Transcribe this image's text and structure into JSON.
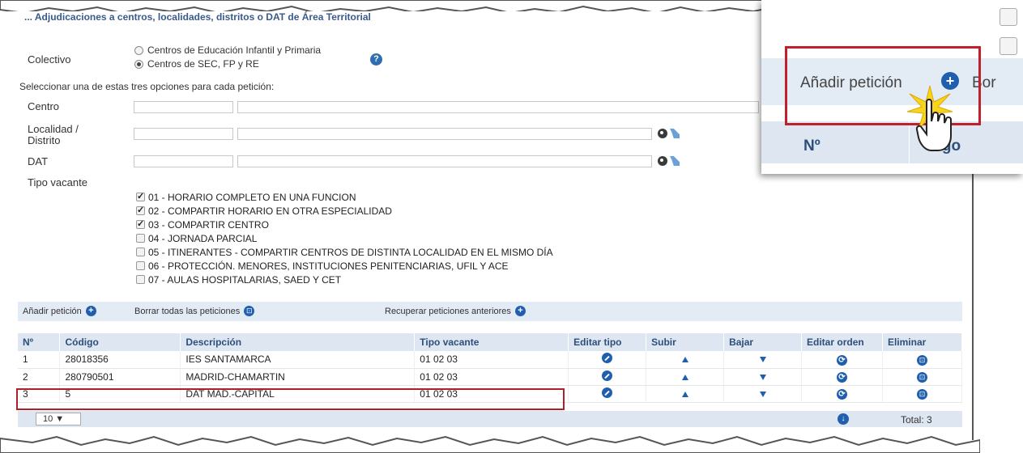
{
  "header": {
    "title": "... Adjudicaciones a centros, localidades, distritos o DAT de Área Territorial"
  },
  "form": {
    "colectivo_label": "Colectivo",
    "colectivo_options": [
      "Centros de Educación Infantil y Primaria",
      "Centros de SEC, FP y RE"
    ],
    "colectivo_selected": "Centros de SEC, FP y RE",
    "instruction": "Seleccionar una de estas tres opciones para cada petición:",
    "centro_label": "Centro",
    "localidad_label": "Localidad / Distrito",
    "dat_label": "DAT",
    "tipo_vacante_label": "Tipo vacante",
    "tipo_vacante_options": [
      {
        "label": "01 - HORARIO COMPLETO EN UNA FUNCION",
        "checked": true
      },
      {
        "label": "02 - COMPARTIR HORARIO EN OTRA ESPECIALIDAD",
        "checked": true
      },
      {
        "label": "03 - COMPARTIR CENTRO",
        "checked": true
      },
      {
        "label": "04 - JORNADA PARCIAL",
        "checked": false
      },
      {
        "label": "05 - ITINERANTES - COMPARTIR CENTROS DE DISTINTA LOCALIDAD EN EL MISMO DÍA",
        "checked": false
      },
      {
        "label": "06 - PROTECCIÓN. MENORES, INSTITUCIONES PENITENCIARIAS, UFIL Y ACE",
        "checked": false
      },
      {
        "label": "07 - AULAS HOSPITALARIAS, SAED Y CET",
        "checked": false
      }
    ]
  },
  "actions": {
    "add": "Añadir petición",
    "delete_all": "Borrar todas las peticiones",
    "recover": "Recuperar peticiones anteriores"
  },
  "table": {
    "headers": [
      "Nº",
      "Código",
      "Descripción",
      "Tipo vacante",
      "Editar tipo",
      "Subir",
      "Bajar",
      "Editar orden",
      "Eliminar"
    ],
    "rows": [
      {
        "n": "1",
        "codigo": "28018356",
        "descripcion": "IES SANTAMARCA",
        "tipo": "01 02 03"
      },
      {
        "n": "2",
        "codigo": "280790501",
        "descripcion": "MADRID-CHAMARTIN",
        "tipo": "01 02 03"
      },
      {
        "n": "3",
        "codigo": "5",
        "descripcion": "DAT MAD.-CAPITAL",
        "tipo": "01 02 03"
      }
    ]
  },
  "pager": {
    "page_size": "10 ▼",
    "total": "Total: 3"
  },
  "zoom": {
    "add_label": "Añadir petición",
    "next_label": "Bor",
    "col_no": "Nº",
    "col_codigo": "digo"
  },
  "colors": {
    "accent": "#1f5fae",
    "highlight": "#b0202a",
    "header_bg": "#dde6f1"
  }
}
